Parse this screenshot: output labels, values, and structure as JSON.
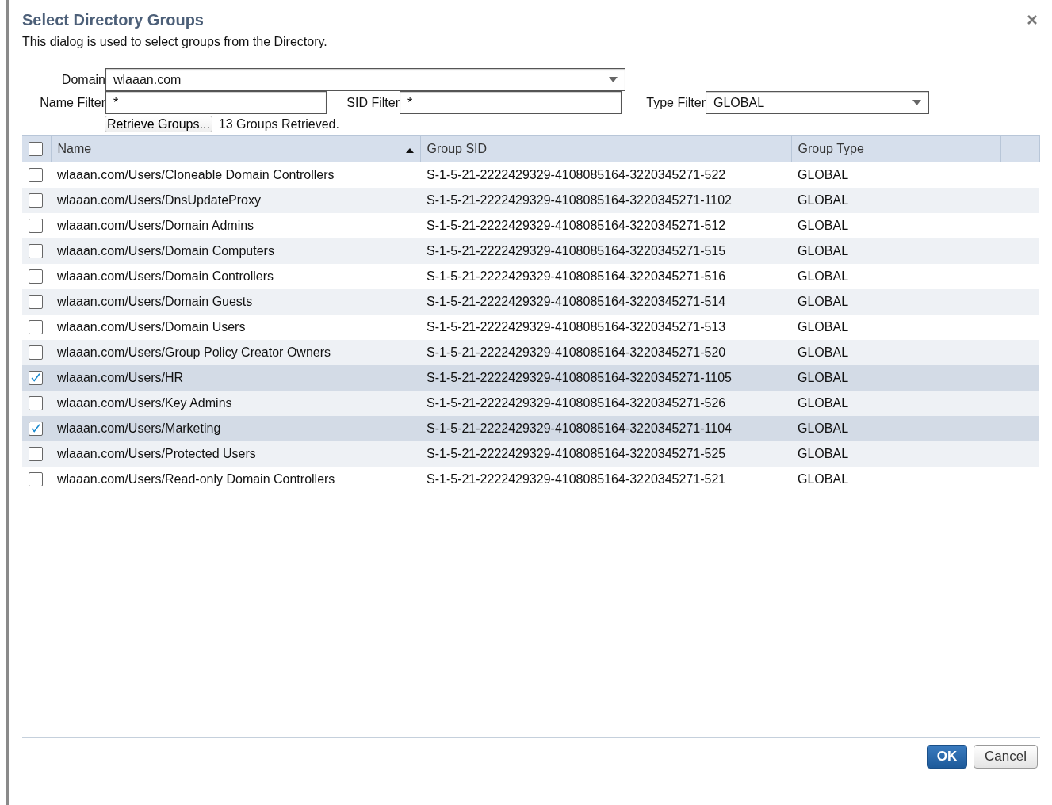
{
  "dialog": {
    "title": "Select Directory Groups",
    "description": "This dialog is used to select groups from the Directory."
  },
  "form": {
    "domain": {
      "label": "Domain",
      "value": "wlaaan.com"
    },
    "name_filter": {
      "label": "Name Filter",
      "value": "*"
    },
    "sid_filter": {
      "label": "SID Filter",
      "value": "*"
    },
    "type_filter": {
      "label": "Type Filter",
      "value": "GLOBAL"
    },
    "retrieve_button": "Retrieve Groups...",
    "status": "13 Groups Retrieved."
  },
  "table": {
    "select_all": {
      "checked": false
    },
    "columns": [
      {
        "label": "Name",
        "sorted": true
      },
      {
        "label": "Group SID"
      },
      {
        "label": "Group Type"
      }
    ],
    "rows": [
      {
        "name": "wlaaan.com/Users/Cloneable Domain Controllers",
        "sid": "S-1-5-21-2222429329-4108085164-3220345271-522",
        "type": "GLOBAL",
        "checked": false
      },
      {
        "name": "wlaaan.com/Users/DnsUpdateProxy",
        "sid": "S-1-5-21-2222429329-4108085164-3220345271-1102",
        "type": "GLOBAL",
        "checked": false
      },
      {
        "name": "wlaaan.com/Users/Domain Admins",
        "sid": "S-1-5-21-2222429329-4108085164-3220345271-512",
        "type": "GLOBAL",
        "checked": false
      },
      {
        "name": "wlaaan.com/Users/Domain Computers",
        "sid": "S-1-5-21-2222429329-4108085164-3220345271-515",
        "type": "GLOBAL",
        "checked": false
      },
      {
        "name": "wlaaan.com/Users/Domain Controllers",
        "sid": "S-1-5-21-2222429329-4108085164-3220345271-516",
        "type": "GLOBAL",
        "checked": false
      },
      {
        "name": "wlaaan.com/Users/Domain Guests",
        "sid": "S-1-5-21-2222429329-4108085164-3220345271-514",
        "type": "GLOBAL",
        "checked": false
      },
      {
        "name": "wlaaan.com/Users/Domain Users",
        "sid": "S-1-5-21-2222429329-4108085164-3220345271-513",
        "type": "GLOBAL",
        "checked": false
      },
      {
        "name": "wlaaan.com/Users/Group Policy Creator Owners",
        "sid": "S-1-5-21-2222429329-4108085164-3220345271-520",
        "type": "GLOBAL",
        "checked": false
      },
      {
        "name": "wlaaan.com/Users/HR",
        "sid": "S-1-5-21-2222429329-4108085164-3220345271-1105",
        "type": "GLOBAL",
        "checked": true
      },
      {
        "name": "wlaaan.com/Users/Key Admins",
        "sid": "S-1-5-21-2222429329-4108085164-3220345271-526",
        "type": "GLOBAL",
        "checked": false
      },
      {
        "name": "wlaaan.com/Users/Marketing",
        "sid": "S-1-5-21-2222429329-4108085164-3220345271-1104",
        "type": "GLOBAL",
        "checked": true
      },
      {
        "name": "wlaaan.com/Users/Protected Users",
        "sid": "S-1-5-21-2222429329-4108085164-3220345271-525",
        "type": "GLOBAL",
        "checked": false
      },
      {
        "name": "wlaaan.com/Users/Read-only Domain Controllers",
        "sid": "S-1-5-21-2222429329-4108085164-3220345271-521",
        "type": "GLOBAL",
        "checked": false
      }
    ]
  },
  "buttons": {
    "ok": "OK",
    "cancel": "Cancel"
  }
}
